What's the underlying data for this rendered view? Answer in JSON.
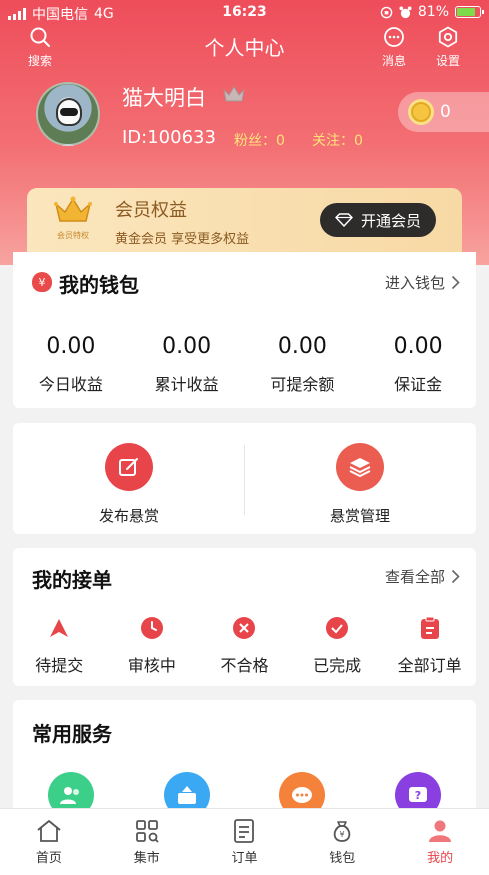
{
  "status_bar": {
    "carrier": "中国电信",
    "network": "4G",
    "time": "16:23",
    "battery": "81%"
  },
  "nav": {
    "title": "个人中心",
    "search_label": "搜索",
    "messages_label": "消息",
    "settings_label": "设置"
  },
  "profile": {
    "username": "猫大明白",
    "id": "ID:100633",
    "fans": "粉丝：0",
    "follows": "关注：0",
    "coins": "0"
  },
  "vip": {
    "badge_caption": "会员特权",
    "title": "会员权益",
    "description": "黄金会员  享受更多权益",
    "button": "开通会员"
  },
  "wallet": {
    "title": "我的钱包",
    "link": "进入钱包",
    "icon_glyph": "¥",
    "stats": [
      {
        "value": "0.00",
        "label": "今日收益"
      },
      {
        "value": "0.00",
        "label": "累计收益"
      },
      {
        "value": "0.00",
        "label": "可提余额"
      },
      {
        "value": "0.00",
        "label": "保证金"
      }
    ]
  },
  "actions": [
    {
      "label": "发布悬赏",
      "icon": "edit-icon"
    },
    {
      "label": "悬赏管理",
      "icon": "layers-icon"
    }
  ],
  "orders": {
    "title": "我的接单",
    "link": "查看全部",
    "items": [
      {
        "label": "待提交",
        "icon": "send-icon"
      },
      {
        "label": "审核中",
        "icon": "clock-icon"
      },
      {
        "label": "不合格",
        "icon": "x-circle-icon"
      },
      {
        "label": "已完成",
        "icon": "check-circle-icon"
      },
      {
        "label": "全部订单",
        "icon": "clipboard-icon"
      }
    ]
  },
  "services": {
    "title": "常用服务",
    "icons": [
      "users-icon",
      "share-box-icon",
      "chat-icon",
      "help-icon"
    ]
  },
  "tabs": [
    {
      "label": "首页",
      "icon": "home-icon",
      "active": false
    },
    {
      "label": "集市",
      "icon": "grid-icon",
      "active": false
    },
    {
      "label": "订单",
      "icon": "document-icon",
      "active": false
    },
    {
      "label": "钱包",
      "icon": "money-bag-icon",
      "active": false
    },
    {
      "label": "我的",
      "icon": "user-icon",
      "active": true
    }
  ],
  "colors": {
    "brand_red": "#e8454b",
    "header_gradient_top": "#ee4d5a",
    "vip_gold": "#f7d9a5",
    "highlight_yellow": "#ffe27a"
  }
}
